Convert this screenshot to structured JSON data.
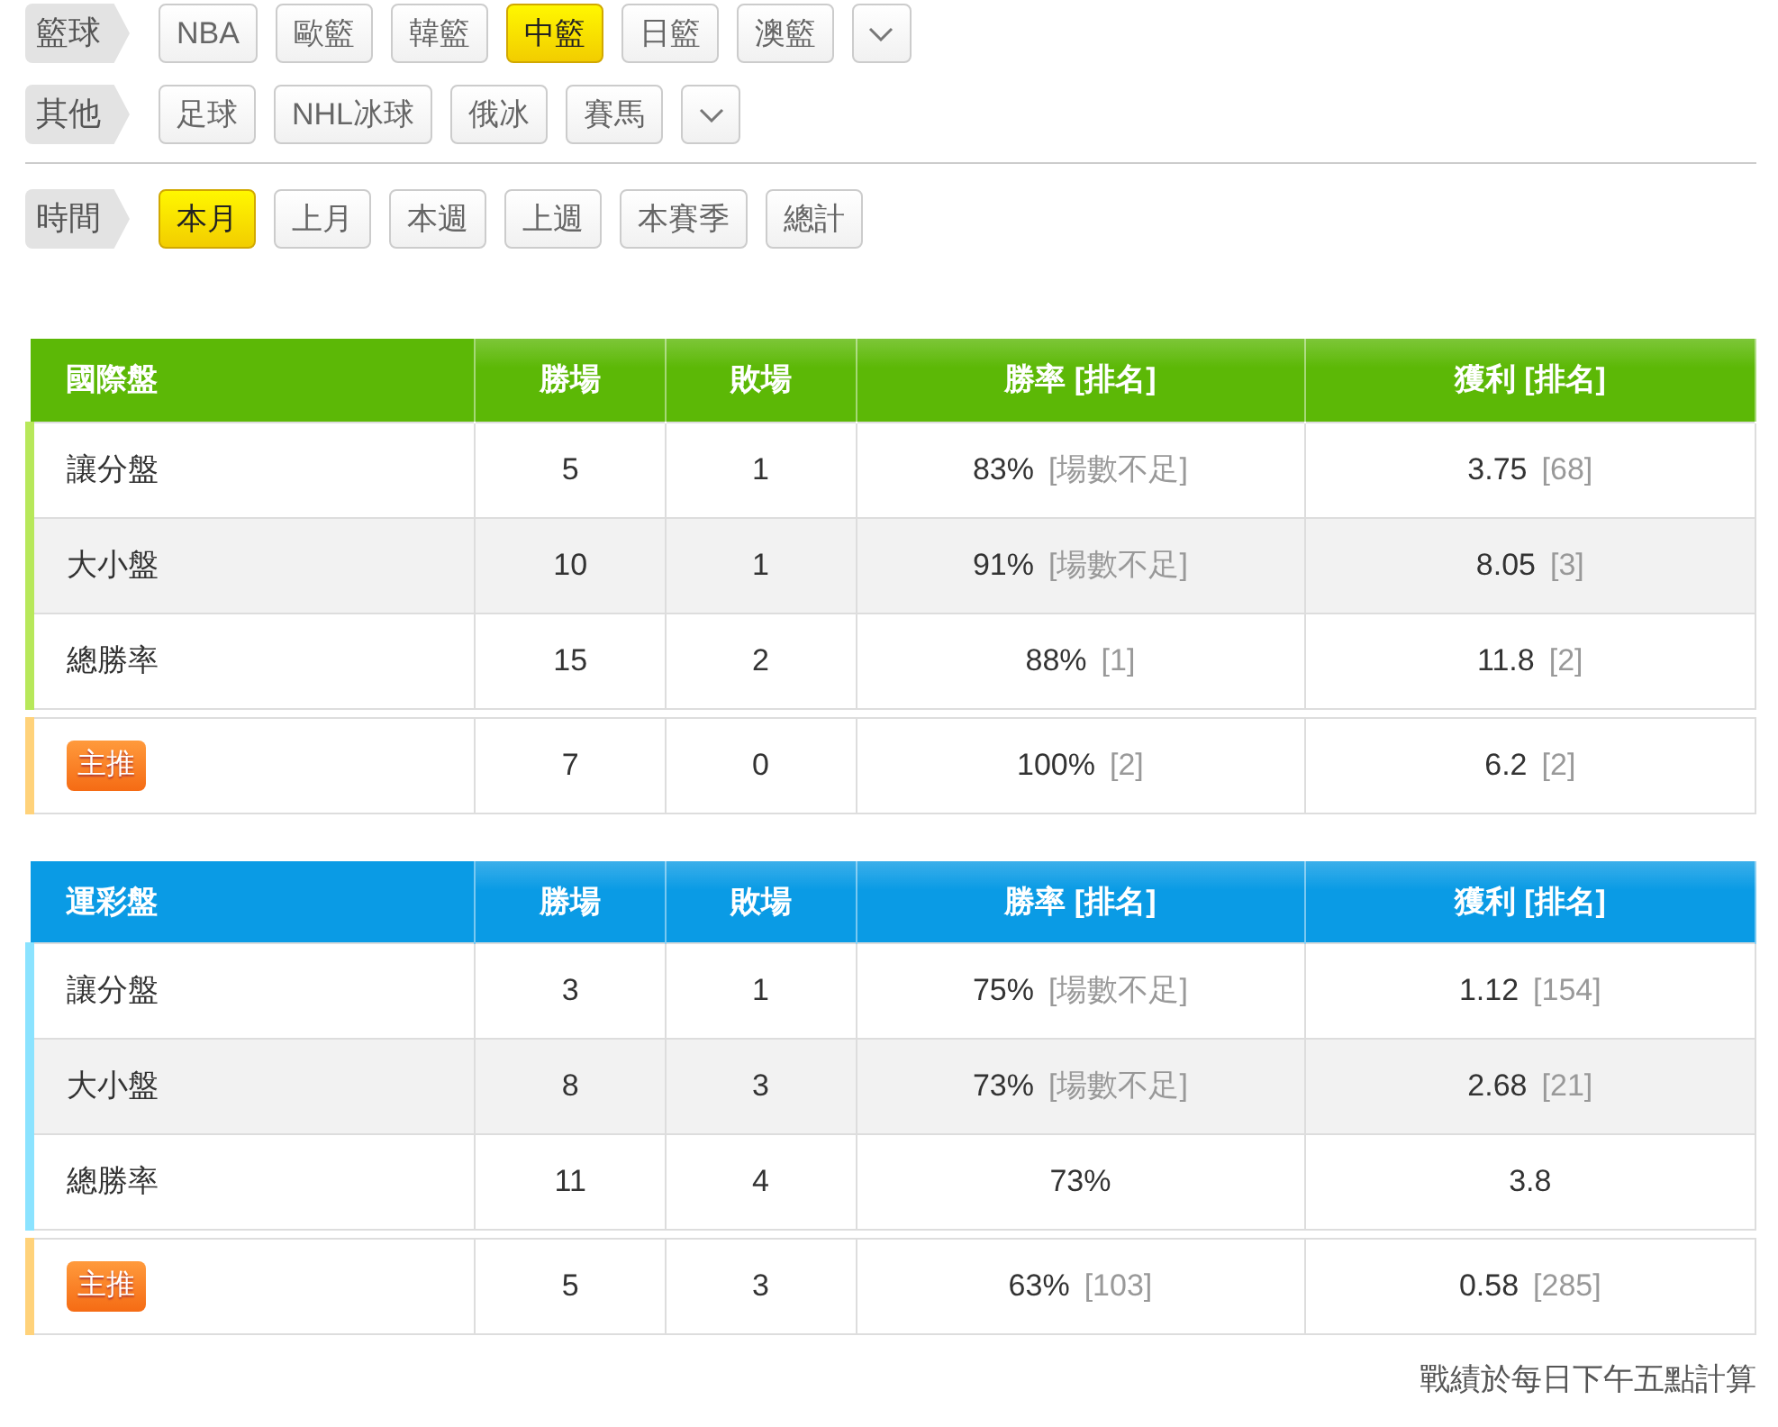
{
  "filters": [
    {
      "label": "籃球",
      "expandable": true,
      "options": [
        {
          "label": "NBA",
          "selected": false
        },
        {
          "label": "歐籃",
          "selected": false
        },
        {
          "label": "韓籃",
          "selected": false
        },
        {
          "label": "中籃",
          "selected": true
        },
        {
          "label": "日籃",
          "selected": false
        },
        {
          "label": "澳籃",
          "selected": false
        }
      ]
    },
    {
      "label": "其他",
      "expandable": true,
      "options": [
        {
          "label": "足球",
          "selected": false
        },
        {
          "label": "NHL冰球",
          "selected": false
        },
        {
          "label": "俄冰",
          "selected": false
        },
        {
          "label": "賽馬",
          "selected": false
        }
      ]
    },
    {
      "label": "時間",
      "expandable": false,
      "options": [
        {
          "label": "本月",
          "selected": true
        },
        {
          "label": "上月",
          "selected": false
        },
        {
          "label": "本週",
          "selected": false
        },
        {
          "label": "上週",
          "selected": false
        },
        {
          "label": "本賽季",
          "selected": false
        },
        {
          "label": "總計",
          "selected": false
        }
      ]
    }
  ],
  "tables": [
    {
      "color": "#5cb806",
      "columns": [
        "國際盤",
        "勝場",
        "敗場",
        "勝率 [排名]",
        "獲利 [排名]"
      ],
      "rows": [
        {
          "kind": "normal",
          "label": "讓分盤",
          "wins": "5",
          "losses": "1",
          "rate": "83%",
          "rate_rank": "[場數不足]",
          "profit": "3.75",
          "profit_rank": "[68]"
        },
        {
          "kind": "normal",
          "label": "大小盤",
          "wins": "10",
          "losses": "1",
          "rate": "91%",
          "rate_rank": "[場數不足]",
          "profit": "8.05",
          "profit_rank": "[3]"
        },
        {
          "kind": "normal",
          "label": "總勝率",
          "wins": "15",
          "losses": "2",
          "rate": "88%",
          "rate_rank": "[1]",
          "profit": "11.8",
          "profit_rank": "[2]"
        },
        {
          "kind": "featured",
          "label": "主推",
          "wins": "7",
          "losses": "0",
          "rate": "100%",
          "rate_rank": "[2]",
          "profit": "6.2",
          "profit_rank": "[2]"
        }
      ]
    },
    {
      "color": "#0a9be5",
      "columns": [
        "運彩盤",
        "勝場",
        "敗場",
        "勝率 [排名]",
        "獲利 [排名]"
      ],
      "rows": [
        {
          "kind": "normal",
          "label": "讓分盤",
          "wins": "3",
          "losses": "1",
          "rate": "75%",
          "rate_rank": "[場數不足]",
          "profit": "1.12",
          "profit_rank": "[154]"
        },
        {
          "kind": "normal",
          "label": "大小盤",
          "wins": "8",
          "losses": "3",
          "rate": "73%",
          "rate_rank": "[場數不足]",
          "profit": "2.68",
          "profit_rank": "[21]"
        },
        {
          "kind": "normal",
          "label": "總勝率",
          "wins": "11",
          "losses": "4",
          "rate": "73%",
          "profit": "3.8"
        },
        {
          "kind": "featured",
          "label": "主推",
          "wins": "5",
          "losses": "3",
          "rate": "63%",
          "rate_rank": "[103]",
          "profit": "0.58",
          "profit_rank": "[285]"
        }
      ]
    }
  ],
  "footnote": "戰績於每日下午五點計算"
}
